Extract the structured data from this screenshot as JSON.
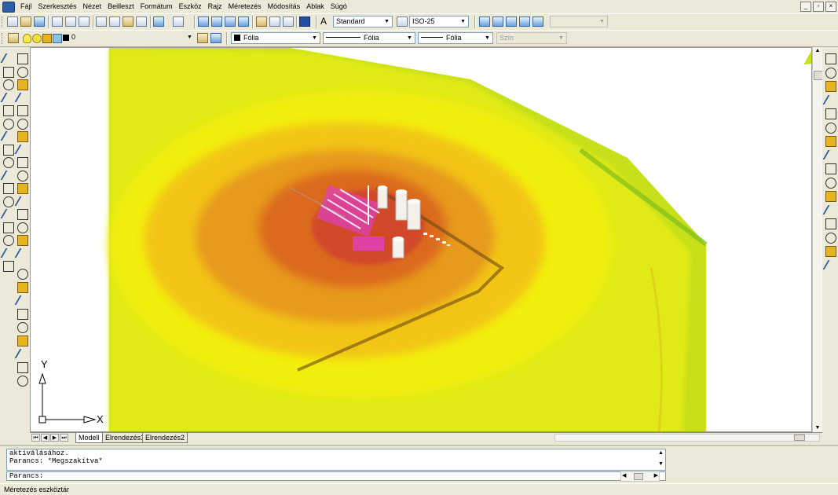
{
  "menu": {
    "items": [
      "Fájl",
      "Szerkesztés",
      "Nézet",
      "Beilleszt",
      "Formátum",
      "Eszköz",
      "Rajz",
      "Méretezés",
      "Módosítás",
      "Ablak",
      "Súgó"
    ],
    "window_buttons": [
      "_",
      "▫",
      "×"
    ]
  },
  "toolbar1": {
    "text_style": "Standard",
    "dim_style": "ISO-25",
    "extra_combo": ""
  },
  "toolbar2": {
    "layer": "0",
    "color": "Fólia",
    "linetype": "Fólia",
    "lineweight": "Fólia",
    "plot_style": "Szín"
  },
  "tabs": {
    "nav": [
      "⏮",
      "◀",
      "▶",
      "⏭"
    ],
    "items": [
      "Modell",
      "Elrendezés1",
      "Elrendezés2"
    ],
    "active": "Modell"
  },
  "ucs": {
    "x_label": "X",
    "y_label": "Y"
  },
  "command": {
    "history": [
      "aktiválásához.",
      "Parancs: *Megszakítva*"
    ],
    "prompt": "Parancs:"
  },
  "status": {
    "text": "Méretezés eszköztár"
  },
  "colors": {
    "yellow_green": "#c8e01a",
    "yellow": "#f2ee0e",
    "gold": "#f2c418",
    "orange": "#e79a1c",
    "deep_orange": "#db6a1e",
    "red": "#d24a2a",
    "magenta": "#e040c0"
  }
}
